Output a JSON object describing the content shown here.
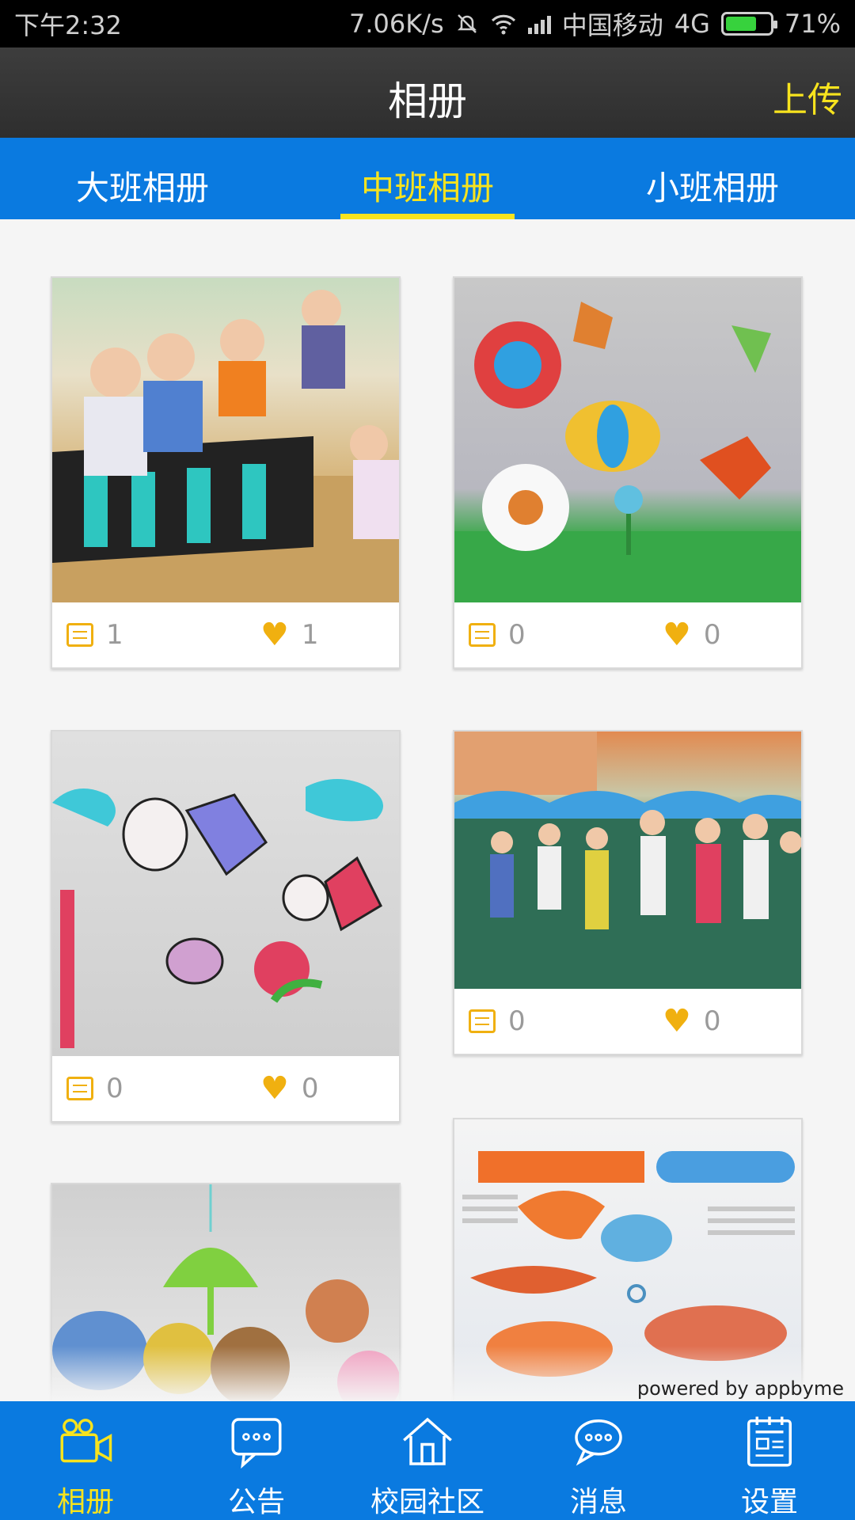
{
  "status_bar": {
    "time": "下午2:32",
    "speed": "7.06K/s",
    "carrier": "中国移动",
    "network": "4G",
    "battery": "71%"
  },
  "header": {
    "title": "相册",
    "upload_label": "上传"
  },
  "tabs": [
    {
      "label": "大班相册",
      "active": false
    },
    {
      "label": "中班相册",
      "active": true
    },
    {
      "label": "小班相册",
      "active": false
    }
  ],
  "albums": [
    {
      "comments": "1",
      "likes": "1",
      "picture": "children sorting beads at a classroom table"
    },
    {
      "comments": "0",
      "likes": "0",
      "picture": "paper butterflies and flowers craft on wall"
    },
    {
      "comments": "0",
      "likes": "0",
      "picture": "crayon drawing of insects and flowers"
    },
    {
      "comments": "0",
      "likes": "0",
      "picture": "children walking in line on playground"
    },
    {
      "picture": "paper umbrella and animal craft"
    },
    {
      "picture": "worksheet page with colored fish illustrations"
    }
  ],
  "footer_credit": "powered by appbyme",
  "bottom_nav": [
    {
      "label": "相册",
      "icon": "camera-icon",
      "active": true
    },
    {
      "label": "公告",
      "icon": "chat-bubble-icon",
      "active": false
    },
    {
      "label": "校园社区",
      "icon": "home-icon",
      "active": false
    },
    {
      "label": "消息",
      "icon": "message-icon",
      "active": false
    },
    {
      "label": "设置",
      "icon": "settings-clipboard-icon",
      "active": false
    }
  ],
  "colors": {
    "brand_blue": "#0a7ae0",
    "accent_yellow": "#f7e31e",
    "icon_gold": "#f0b010",
    "header_dark": "#333333"
  }
}
